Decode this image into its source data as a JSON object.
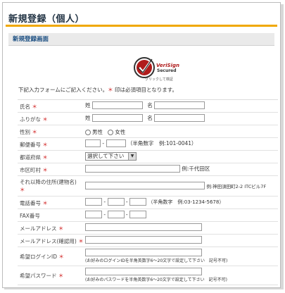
{
  "page": {
    "title": "新規登録（個人）"
  },
  "section": {
    "title": "新規登録画面"
  },
  "seal": {
    "brand": "VeriSign",
    "secured": "Secured",
    "click": "クリックして検証"
  },
  "intro": {
    "text": "下記入力フォームにご記入ください。",
    "mark": "＊",
    "text2": " 印は必須項目となります。"
  },
  "form": {
    "name": {
      "label": "氏名",
      "sei": "姓",
      "mei": "名"
    },
    "kana": {
      "label": "ふりがな",
      "sei": "姓",
      "mei": "名"
    },
    "gender": {
      "label": "性別",
      "male": "男性",
      "female": "女性"
    },
    "zip": {
      "label": "郵便番号",
      "dash": "-",
      "hint": "（半角数字　例:101-0041）"
    },
    "pref": {
      "label": "都道府県",
      "selected": "選択して下さい"
    },
    "city": {
      "label": "市区町村",
      "hint": "例:千代田区"
    },
    "address": {
      "label": "それ以降の住所(建物名)",
      "hint": "例:神田須田町2-2 ITCビル7F"
    },
    "phone": {
      "label": "電話番号",
      "dash": "-",
      "hint": "（半角数字　例:03-1234-5678）"
    },
    "fax": {
      "label": "FAX番号",
      "dash": "-"
    },
    "email": {
      "label": "メールアドレス"
    },
    "email_confirm": {
      "label": "メールアドレス(確認用)"
    },
    "login_id": {
      "label": "希望ログインID",
      "hint": "(お好みのログインIDを半角英数字6～20文字で設定して下さい　記号不可)"
    },
    "password": {
      "label": "希望パスワード",
      "hint": "(お好みのパスワードを半角英数字6～20文字で設定して下さい　記号不可)"
    },
    "required_mark": "＊"
  },
  "colors": {
    "accent": "#f0a800",
    "section_text": "#1c4f82",
    "required": "#d02020"
  }
}
